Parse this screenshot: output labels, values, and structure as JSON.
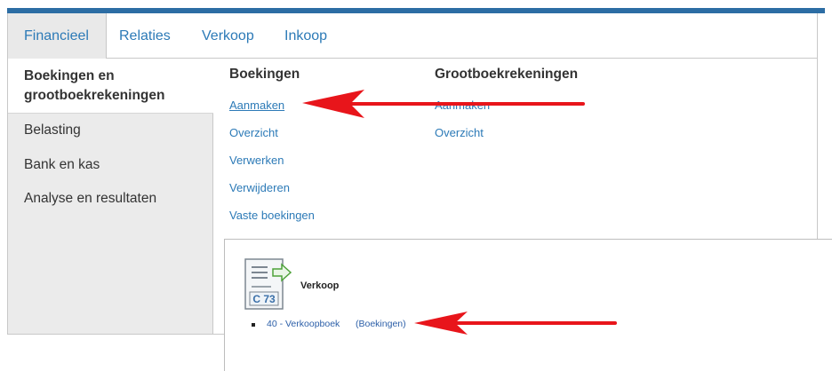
{
  "tabs": [
    {
      "label": "Financieel",
      "active": true
    },
    {
      "label": "Relaties"
    },
    {
      "label": "Verkoop"
    },
    {
      "label": "Inkoop"
    }
  ],
  "sidebar": {
    "active_label": "Boekingen en grootboekrekeningen",
    "items": [
      {
        "label": "Belasting"
      },
      {
        "label": "Bank en kas"
      },
      {
        "label": "Analyse en resultaten"
      }
    ]
  },
  "boekingen": {
    "heading": "Boekingen",
    "links": [
      "Aanmaken",
      "Overzicht",
      "Verwerken",
      "Verwijderen",
      "Vaste boekingen"
    ]
  },
  "grootboek": {
    "heading": "Grootboekrekeningen",
    "links": [
      "Aanmaken",
      "Overzicht"
    ]
  },
  "overlay": {
    "icon_text": "C 73",
    "title": "Verkoop",
    "item_link": "40 - Verkoopboek",
    "item_sublink": "(Boekingen)"
  },
  "colors": {
    "accent_bar": "#2c6da4",
    "link": "#2c7ab7",
    "arrow": "#e8151b",
    "sidebar_bg": "#ebebeb"
  }
}
